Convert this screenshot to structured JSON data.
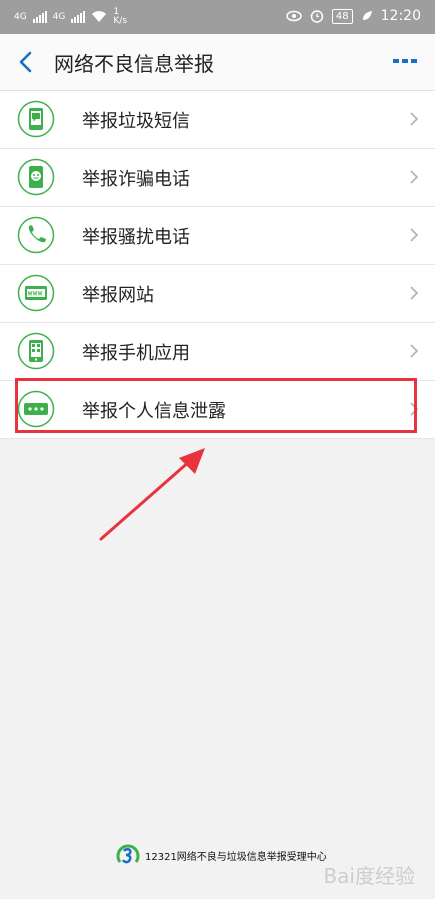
{
  "status": {
    "network_1": "4G",
    "network_2": "4G",
    "speed_value": "1",
    "speed_unit": "K/s",
    "battery": "48",
    "time": "12:20"
  },
  "header": {
    "title": "网络不良信息举报"
  },
  "list": [
    {
      "label": "举报垃圾短信",
      "icon": "sms-icon"
    },
    {
      "label": "举报诈骗电话",
      "icon": "fraud-call-icon"
    },
    {
      "label": "举报骚扰电话",
      "icon": "phone-icon"
    },
    {
      "label": "举报网站",
      "icon": "website-icon"
    },
    {
      "label": "举报手机应用",
      "icon": "mobile-app-icon"
    },
    {
      "label": "举报个人信息泄露",
      "icon": "personal-info-icon"
    }
  ],
  "footer": {
    "text": "12321网络不良与垃圾信息举报受理中心"
  },
  "watermark": "Bai度经验",
  "colors": {
    "accent": "#1a6fc2",
    "icon_green": "#3db04b",
    "highlight_red": "#e8323c"
  }
}
